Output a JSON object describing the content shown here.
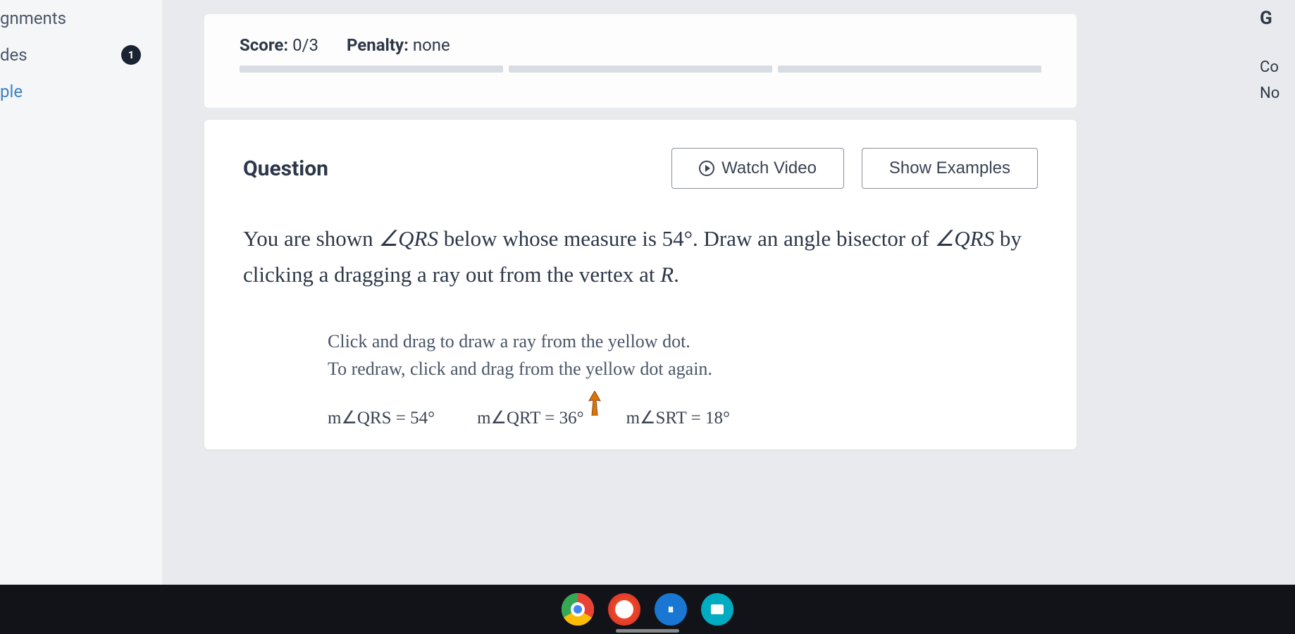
{
  "sidebar": {
    "items": [
      {
        "label": "gnments",
        "badge": null
      },
      {
        "label": "des",
        "badge": "1"
      },
      {
        "label": "ple",
        "badge": null
      }
    ]
  },
  "score": {
    "label": "Score:",
    "value": "0/3",
    "penalty_label": "Penalty:",
    "penalty_value": "none"
  },
  "question": {
    "heading": "Question",
    "watch_video": "Watch Video",
    "show_examples": "Show Examples",
    "text_parts": {
      "p1": "You are shown ",
      "angle1": "∠QRS",
      "p2": " below whose measure is ",
      "deg": "54°",
      "p3": ". Draw an angle bisector of ",
      "angle2": "∠QRS",
      "p4": " by clicking a dragging a ray out from the vertex at ",
      "vertex": "R",
      "p5": "."
    },
    "instructions": {
      "line1": "Click and drag to draw a ray from the yellow dot.",
      "line2": "To redraw, click and drag from the yellow dot again."
    },
    "angles": {
      "a1_label": "m∠QRS = ",
      "a1_val": "54°",
      "a2_label": "m∠QRT = ",
      "a2_val": "36°",
      "a3_label": "m∠SRT = ",
      "a3_val": "18°"
    }
  },
  "right": {
    "items": [
      "G",
      "Co",
      "No"
    ]
  }
}
